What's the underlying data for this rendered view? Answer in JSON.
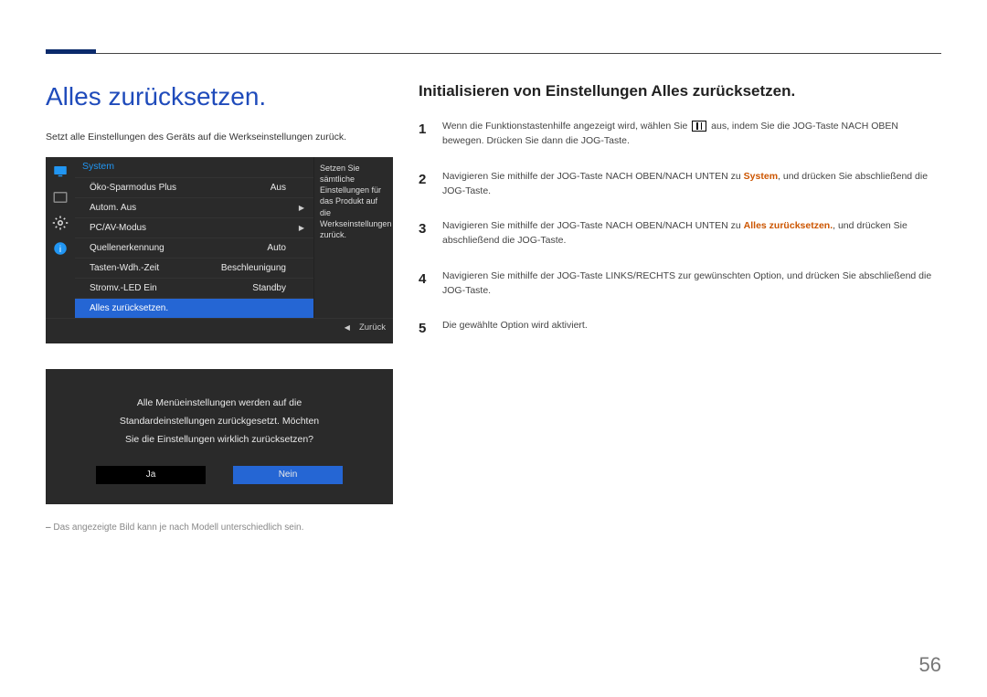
{
  "page": {
    "number": "56"
  },
  "left": {
    "title": "Alles zurücksetzen.",
    "intro": "Setzt alle Einstellungen des Geräts auf die Werkseinstellungen zurück.",
    "note": "Das angezeigte Bild kann je nach Modell unterschiedlich sein."
  },
  "osd": {
    "title": "System",
    "items": [
      {
        "label": "Öko-Sparmodus Plus",
        "value": "Aus"
      },
      {
        "label": "Autom. Aus",
        "value": "",
        "arrow": true
      },
      {
        "label": "PC/AV-Modus",
        "value": "",
        "arrow": true
      },
      {
        "label": "Quellenerkennung",
        "value": "Auto"
      },
      {
        "label": "Tasten-Wdh.-Zeit",
        "value": "Beschleunigung"
      },
      {
        "label": "Stromv.-LED Ein",
        "value": "Standby"
      },
      {
        "label": "Alles zurücksetzen.",
        "value": "",
        "selected": true
      }
    ],
    "desc": "Setzen Sie sämtliche Einstellungen für das Produkt auf die Werkseinstellungen zurück.",
    "back": "Zurück"
  },
  "dialog": {
    "line1": "Alle Menüeinstellungen werden auf die",
    "line2": "Standardeinstellungen zurückgesetzt. Möchten",
    "line3": "Sie die Einstellungen wirklich zurücksetzen?",
    "yes": "Ja",
    "no": "Nein"
  },
  "right": {
    "title": "Initialisieren von Einstellungen Alles zurücksetzen.",
    "steps": [
      {
        "n": "1",
        "pre": "Wenn die Funktionstastenhilfe angezeigt wird, wählen Sie ",
        "post": " aus, indem Sie die JOG-Taste NACH OBEN bewegen. Drücken Sie dann die JOG-Taste.",
        "icon": true
      },
      {
        "n": "2",
        "pre": "Navigieren Sie mithilfe der JOG-Taste NACH OBEN/NACH UNTEN zu ",
        "em": "System",
        "post": ", und drücken Sie abschließend die JOG-Taste."
      },
      {
        "n": "3",
        "pre": "Navigieren Sie mithilfe der JOG-Taste NACH OBEN/NACH UNTEN zu ",
        "em": "Alles zurücksetzen.",
        "post": ", und drücken Sie abschließend die JOG-Taste."
      },
      {
        "n": "4",
        "pre": "Navigieren Sie mithilfe der JOG-Taste LINKS/RECHTS zur gewünschten Option, und drücken Sie abschließend die JOG-Taste."
      },
      {
        "n": "5",
        "pre": "Die gewählte Option wird aktiviert."
      }
    ]
  }
}
